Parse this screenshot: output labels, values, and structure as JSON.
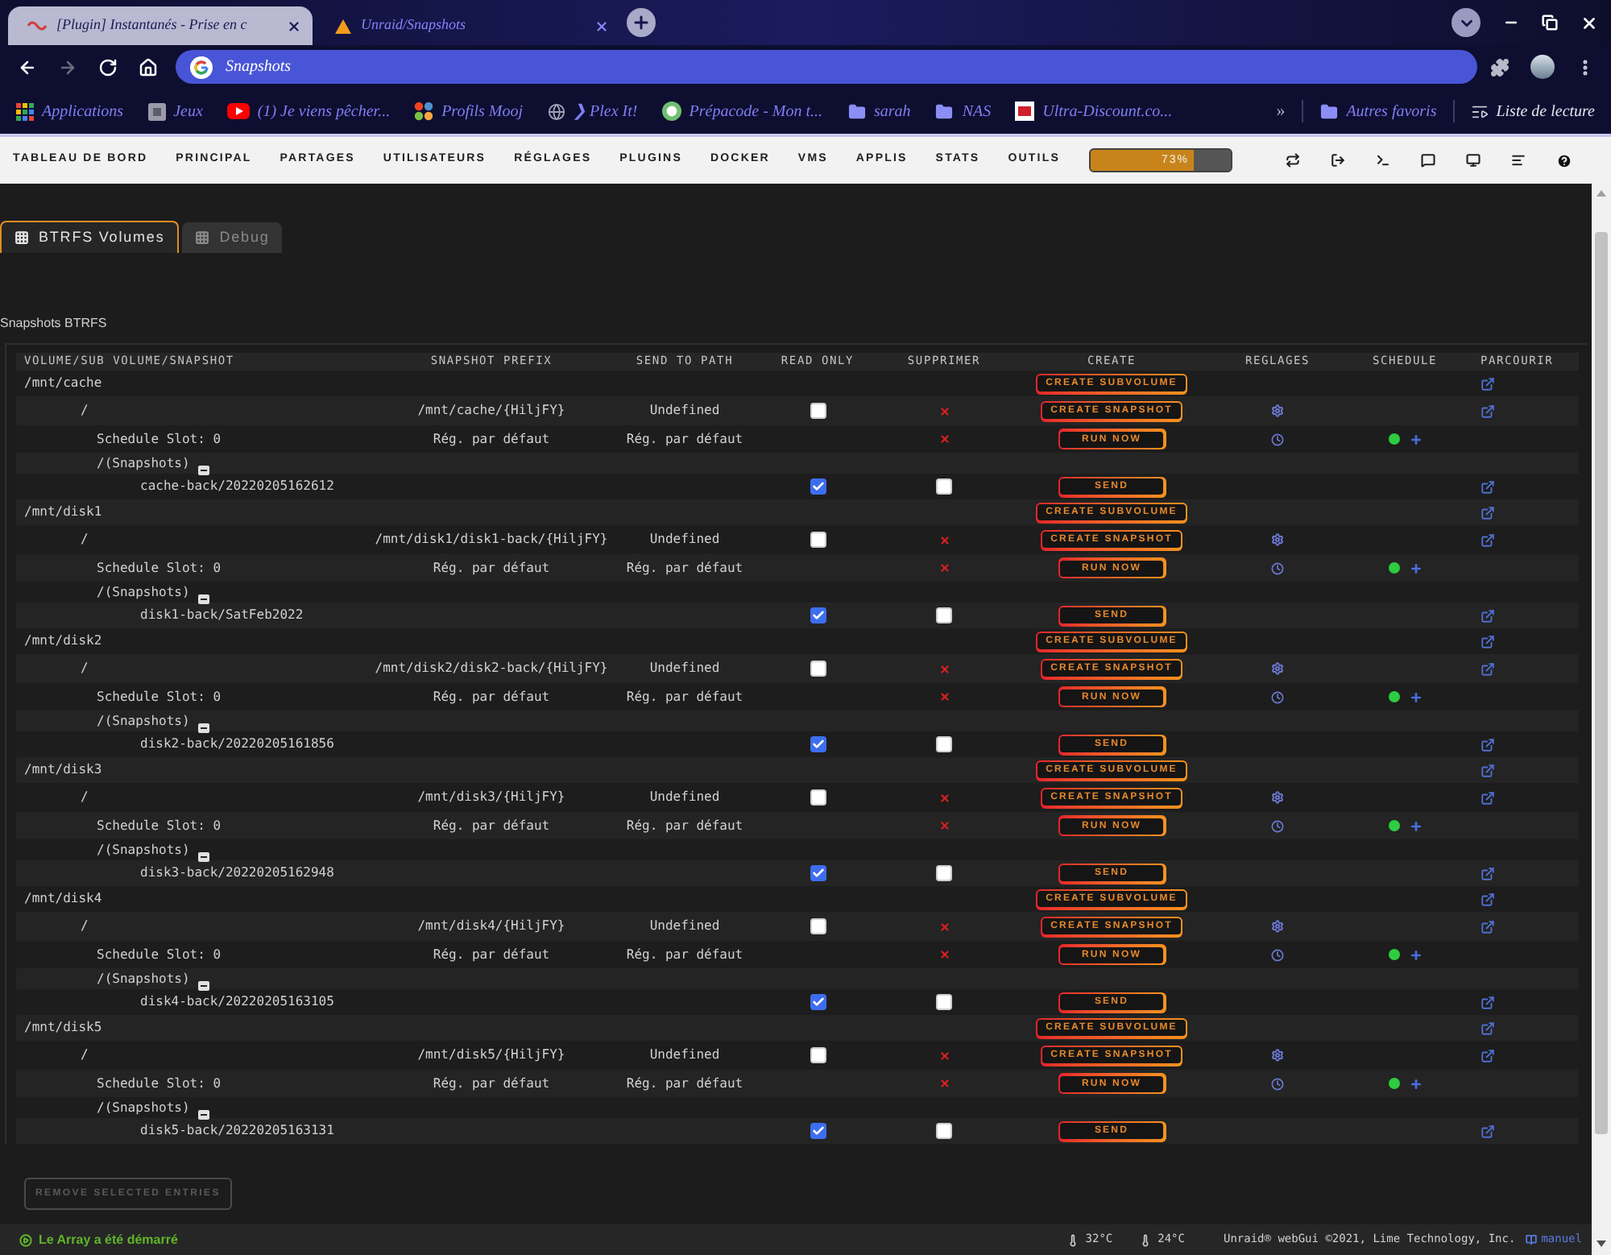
{
  "browser": {
    "tabs": [
      {
        "title": "[Plugin] Instantanés - Prise en c",
        "kind": "forum",
        "selected": false
      },
      {
        "title": "Unraid/Snapshots",
        "kind": "dashboard",
        "selected": true
      }
    ],
    "address": "Snapshots",
    "bookmarks": [
      {
        "label": "Applications",
        "kind": "apps"
      },
      {
        "label": "Jeux",
        "kind": "page"
      },
      {
        "label": "(1) Je viens pêcher...",
        "kind": "video"
      },
      {
        "label": "Profils Mooj",
        "kind": "pinwheel"
      },
      {
        "label": "❯ Plex It!",
        "kind": "link"
      },
      {
        "label": "Prépacode - Mon t...",
        "kind": "ring"
      },
      {
        "label": "sarah",
        "kind": "folder"
      },
      {
        "label": "NAS",
        "kind": "folder"
      },
      {
        "label": "Ultra-Discount.co...",
        "kind": "square"
      }
    ],
    "more": "»",
    "other_bookmarks": "Autres favoris",
    "reading_list": "Liste de lecture"
  },
  "nav": {
    "items": [
      "TABLEAU DE BORD",
      "PRINCIPAL",
      "PARTAGES",
      "UTILISATEURS",
      "RÉGLAGES",
      "PLUGINS",
      "DOCKER",
      "VMS",
      "APPLIS",
      "STATS",
      "OUTILS"
    ],
    "usage": {
      "level": 0.73,
      "label": "73%"
    }
  },
  "page_tabs": [
    {
      "label": "BTRFS Volumes",
      "selected": true
    },
    {
      "label": "Debug",
      "selected": false
    }
  ],
  "section_title": "Snapshots BTRFS",
  "table": {
    "columns": [
      "VOLUME/SUB VOLUME/SNAPSHOT",
      "SNAPSHOT PREFIX",
      "SEND TO PATH",
      "READ ONLY",
      "SUPPRIMER",
      "CREATE",
      "REGLAGES",
      "SCHEDULE",
      "PARCOURIR"
    ],
    "volumes": [
      {
        "path": "/mnt/cache",
        "action": "CREATE SUBVOLUME",
        "children": [
          {
            "path": "/",
            "prefix": "/mnt/cache/{HiljFY}",
            "send_to_path": "Undefined",
            "read_only": false,
            "action": "CREATE SNAPSHOT",
            "children": [
              {
                "kind": "schedule",
                "label": "Schedule Slot: 0",
                "prefix": "Rég. par défaut",
                "send_to_path": "Rég. par défaut",
                "action": "RUN NOW",
                "enabled": true
              },
              {
                "kind": "snapshots",
                "label": "/(Snapshots)",
                "expanded": true,
                "children": [
                  {
                    "path": "cache-back/20220205162612",
                    "read_only": true,
                    "remove_checked": false,
                    "action": "SEND"
                  }
                ]
              }
            ]
          }
        ]
      },
      {
        "path": "/mnt/disk1",
        "action": "CREATE SUBVOLUME",
        "children": [
          {
            "path": "/",
            "prefix": "/mnt/disk1/disk1-back/{HiljFY}",
            "send_to_path": "Undefined",
            "read_only": false,
            "action": "CREATE SNAPSHOT",
            "children": [
              {
                "kind": "schedule",
                "label": "Schedule Slot: 0",
                "prefix": "Rég. par défaut",
                "send_to_path": "Rég. par défaut",
                "action": "RUN NOW",
                "enabled": true
              },
              {
                "kind": "snapshots",
                "label": "/(Snapshots)",
                "expanded": true,
                "children": [
                  {
                    "path": "disk1-back/SatFeb2022",
                    "read_only": true,
                    "remove_checked": false,
                    "action": "SEND"
                  }
                ]
              }
            ]
          }
        ]
      },
      {
        "path": "/mnt/disk2",
        "action": "CREATE SUBVOLUME",
        "children": [
          {
            "path": "/",
            "prefix": "/mnt/disk2/disk2-back/{HiljFY}",
            "send_to_path": "Undefined",
            "read_only": false,
            "action": "CREATE SNAPSHOT",
            "children": [
              {
                "kind": "schedule",
                "label": "Schedule Slot: 0",
                "prefix": "Rég. par défaut",
                "send_to_path": "Rég. par défaut",
                "action": "RUN NOW",
                "enabled": true
              },
              {
                "kind": "snapshots",
                "label": "/(Snapshots)",
                "expanded": true,
                "children": [
                  {
                    "path": "disk2-back/20220205161856",
                    "read_only": true,
                    "remove_checked": false,
                    "action": "SEND"
                  }
                ]
              }
            ]
          }
        ]
      },
      {
        "path": "/mnt/disk3",
        "action": "CREATE SUBVOLUME",
        "children": [
          {
            "path": "/",
            "prefix": "/mnt/disk3/{HiljFY}",
            "send_to_path": "Undefined",
            "read_only": false,
            "action": "CREATE SNAPSHOT",
            "children": [
              {
                "kind": "schedule",
                "label": "Schedule Slot: 0",
                "prefix": "Rég. par défaut",
                "send_to_path": "Rég. par défaut",
                "action": "RUN NOW",
                "enabled": true
              },
              {
                "kind": "snapshots",
                "label": "/(Snapshots)",
                "expanded": true,
                "children": [
                  {
                    "path": "disk3-back/20220205162948",
                    "read_only": true,
                    "remove_checked": false,
                    "action": "SEND"
                  }
                ]
              }
            ]
          }
        ]
      },
      {
        "path": "/mnt/disk4",
        "action": "CREATE SUBVOLUME",
        "children": [
          {
            "path": "/",
            "prefix": "/mnt/disk4/{HiljFY}",
            "send_to_path": "Undefined",
            "read_only": false,
            "action": "CREATE SNAPSHOT",
            "children": [
              {
                "kind": "schedule",
                "label": "Schedule Slot: 0",
                "prefix": "Rég. par défaut",
                "send_to_path": "Rég. par défaut",
                "action": "RUN NOW",
                "enabled": true
              },
              {
                "kind": "snapshots",
                "label": "/(Snapshots)",
                "expanded": true,
                "children": [
                  {
                    "path": "disk4-back/20220205163105",
                    "read_only": true,
                    "remove_checked": false,
                    "action": "SEND"
                  }
                ]
              }
            ]
          }
        ]
      },
      {
        "path": "/mnt/disk5",
        "action": "CREATE SUBVOLUME",
        "children": [
          {
            "path": "/",
            "prefix": "/mnt/disk5/{HiljFY}",
            "send_to_path": "Undefined",
            "read_only": false,
            "action": "CREATE SNAPSHOT",
            "children": [
              {
                "kind": "schedule",
                "label": "Schedule Slot: 0",
                "prefix": "Rég. par défaut",
                "send_to_path": "Rég. par défaut",
                "action": "RUN NOW",
                "enabled": true
              },
              {
                "kind": "snapshots",
                "label": "/(Snapshots)",
                "expanded": true,
                "children": [
                  {
                    "path": "disk5-back/20220205163131",
                    "read_only": true,
                    "remove_checked": false,
                    "action": "SEND"
                  }
                ]
              }
            ]
          }
        ]
      }
    ]
  },
  "remove_button": {
    "label": "REMOVE SELECTED ENTRIES",
    "disabled": true
  },
  "footer": {
    "status": "Le Array a été démarré",
    "temperatures": [
      "32°C",
      "24°C"
    ],
    "copyright": "Unraid® webGui ©2021, Lime Technology, Inc.",
    "manual": "manuel"
  }
}
